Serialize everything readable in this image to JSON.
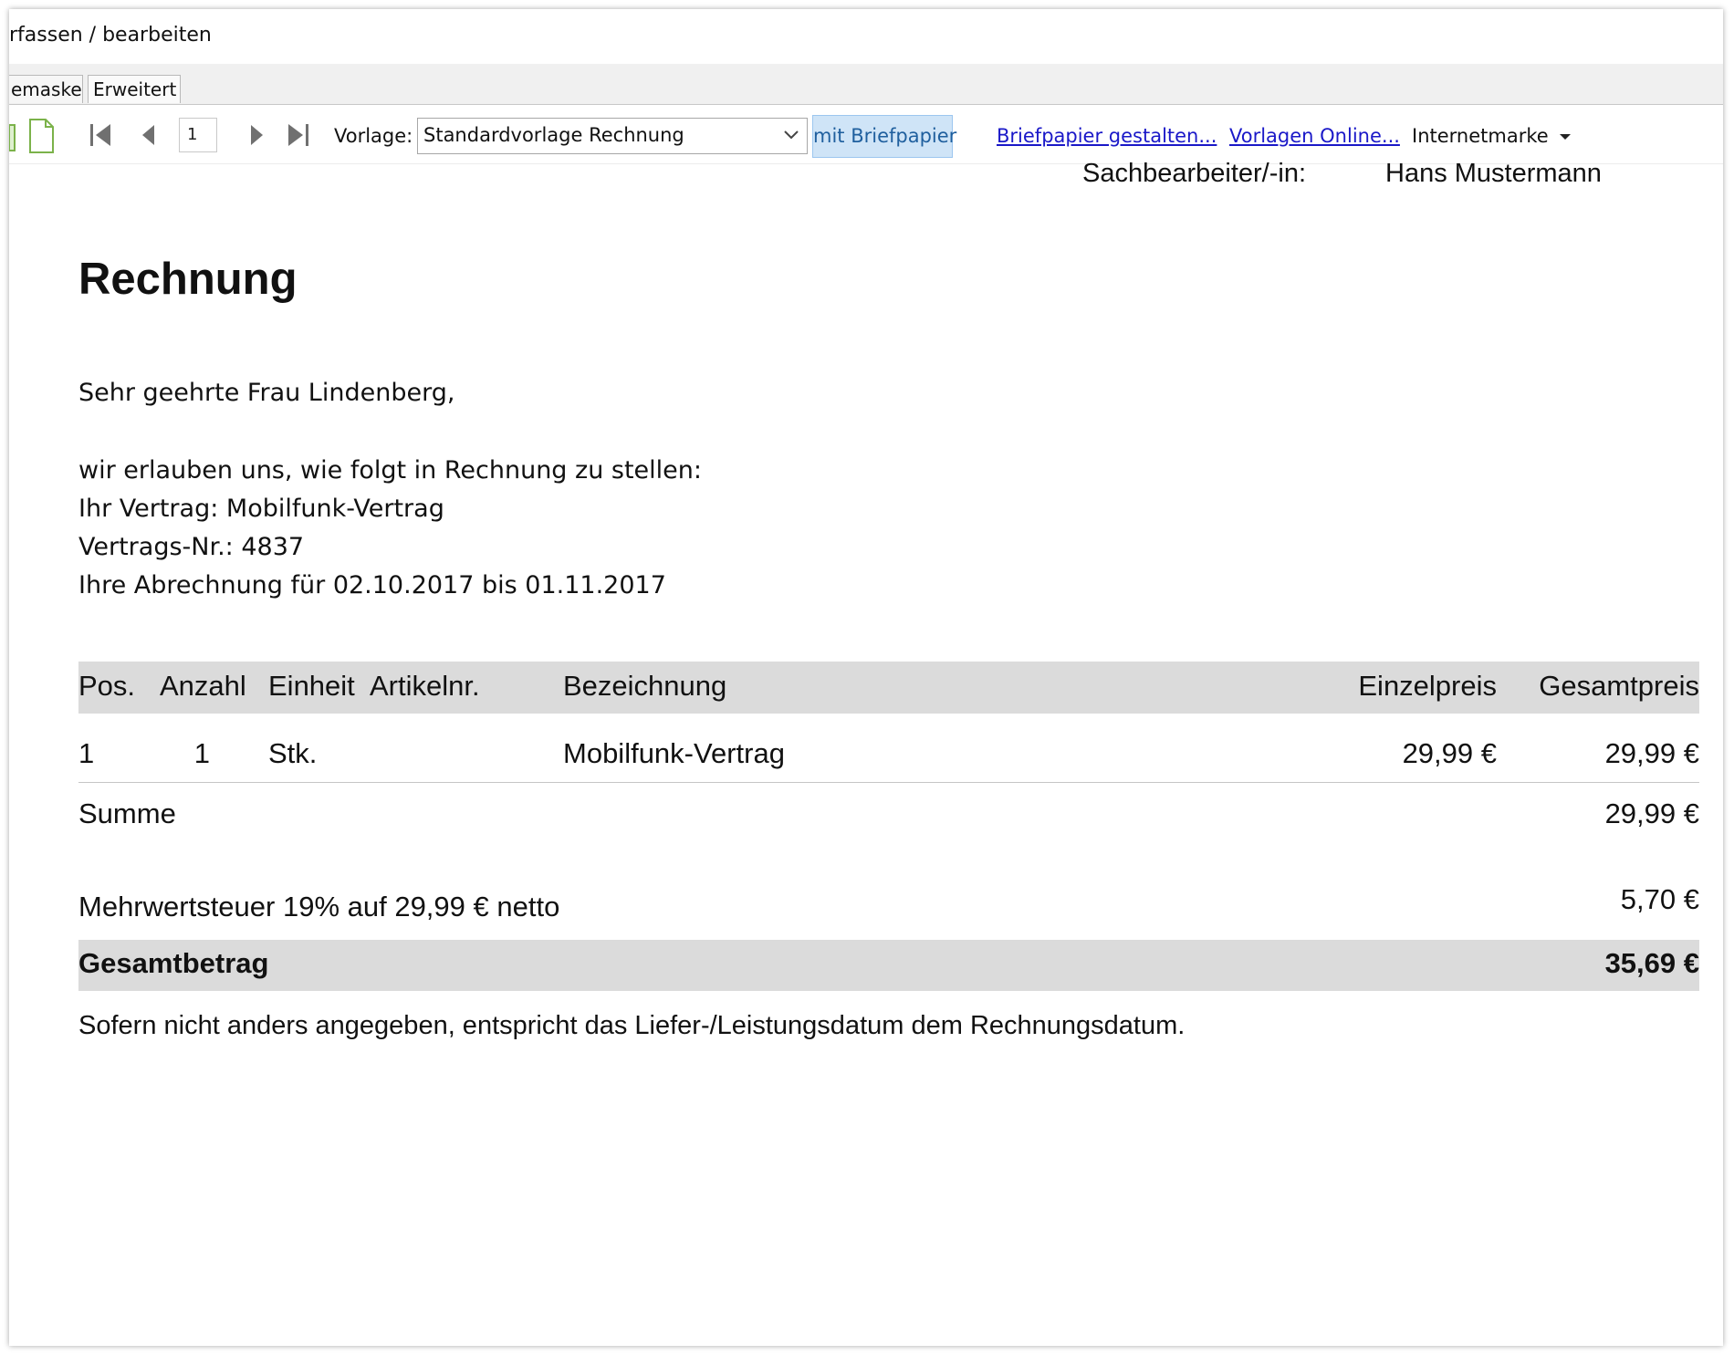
{
  "window": {
    "title": "rfassen / bearbeiten"
  },
  "tabs": [
    {
      "label": "emaske"
    },
    {
      "label": "Erweitert"
    }
  ],
  "toolbar": {
    "page_number": "1",
    "vorlage_label": "Vorlage:",
    "vorlage_value": "Standardvorlage Rechnung",
    "briefpapier_button": "mit Briefpapier",
    "briefpapier_gestalten_link": "Briefpapier gestalten...",
    "vorlagen_online_link": "Vorlagen Online...",
    "internetmarke_menu": "Internetmarke",
    "accent_color": "#cfe4f7",
    "link_color": "#1a18c8"
  },
  "document": {
    "sachbearbeiter_label": "Sachbearbeiter/-in:",
    "sachbearbeiter_name": "Hans Mustermann",
    "title": "Rechnung",
    "salutation": "Sehr geehrte Frau Lindenberg,",
    "intro_lines": [
      "wir erlauben uns, wie folgt in Rechnung zu stellen:",
      "Ihr Vertrag: Mobilfunk-Vertrag",
      "Vertrags-Nr.: 4837",
      "Ihre Abrechnung für 02.10.2017 bis 01.11.2017"
    ],
    "table": {
      "headers": [
        "Pos.",
        "Anzahl",
        "Einheit",
        "Artikelnr.",
        "Bezeichnung",
        "Einzelpreis",
        "Gesamtpreis"
      ],
      "rows": [
        [
          "1",
          "1",
          "Stk.",
          "",
          "Mobilfunk-Vertrag",
          "29,99 €",
          "29,99 €"
        ]
      ]
    },
    "summe_label": "Summe",
    "summe_value": "29,99 €",
    "mwst_label": "Mehrwertsteuer 19% auf 29,99 € netto",
    "mwst_value": "5,70 €",
    "gesamtbetrag_label": "Gesamtbetrag",
    "gesamtbetrag_value": "35,69 €",
    "footer_note": "Sofern nicht anders angegeben, entspricht das Liefer-/Leistungsdatum dem Rechnungsdatum."
  }
}
